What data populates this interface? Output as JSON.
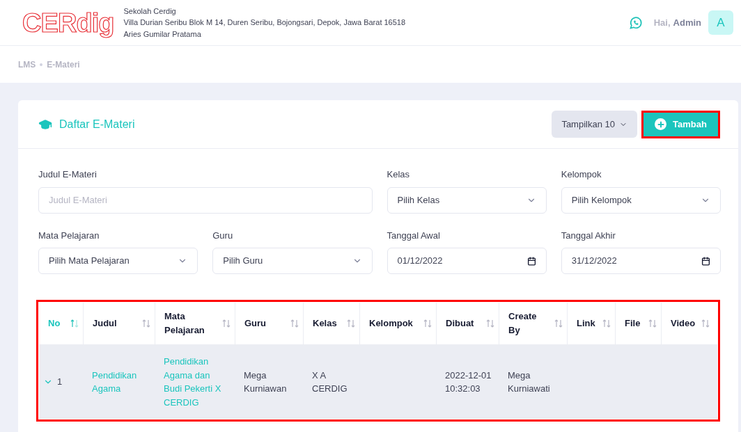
{
  "header": {
    "logo": "CERdig",
    "school_name": "Sekolah Cerdig",
    "address": "Villa Durian Seribu Blok M 14, Duren Seribu, Bojongsari, Depok, Jawa Barat 16518",
    "principal": "Aries Gumilar Pratama",
    "greeting": "Hai,",
    "user_name": "Admin",
    "avatar_initial": "A"
  },
  "breadcrumb": [
    "LMS",
    "E-Materi"
  ],
  "card": {
    "title": "Daftar E-Materi",
    "page_size": "Tampilkan 10",
    "add_button": "Tambah"
  },
  "filters": [
    {
      "kind": "text",
      "label": "Judul E-Materi",
      "placeholder": "Judul E-Materi",
      "wide": true
    },
    {
      "kind": "select",
      "label": "Kelas",
      "value": "Pilih Kelas",
      "wide": false
    },
    {
      "kind": "select",
      "label": "Kelompok",
      "value": "Pilih Kelompok",
      "wide": false
    },
    {
      "kind": "select",
      "label": "Mata Pelajaran",
      "value": "Pilih Mata Pelajaran",
      "wide": false
    },
    {
      "kind": "select",
      "label": "Guru",
      "value": "Pilih Guru",
      "wide": false
    },
    {
      "kind": "date",
      "label": "Tanggal Awal",
      "value": "01/12/2022",
      "wide": false
    },
    {
      "kind": "date",
      "label": "Tanggal Akhir",
      "value": "31/12/2022",
      "wide": false
    }
  ],
  "table": {
    "columns": [
      {
        "label": "No",
        "sorted": true
      },
      {
        "label": "Judul",
        "sorted": false
      },
      {
        "label": "Mata Pelajaran",
        "sorted": false
      },
      {
        "label": "Guru",
        "sorted": false
      },
      {
        "label": "Kelas",
        "sorted": false
      },
      {
        "label": "Kelompok",
        "sorted": false
      },
      {
        "label": "Dibuat",
        "sorted": false
      },
      {
        "label": "Create By",
        "sorted": false
      },
      {
        "label": "Link",
        "sorted": false
      },
      {
        "label": "File",
        "sorted": false
      },
      {
        "label": "Video",
        "sorted": false
      }
    ],
    "rows": [
      {
        "expanded": true,
        "no": "1",
        "judul": "Pendidikan Agama",
        "mata_pelajaran": "Pendidikan Agama dan Budi Pekerti X CERDIG",
        "guru": "Mega Kurniawan",
        "kelas": "X A CERDIG",
        "dibuat": "2022-12-01 10:32:03",
        "create_by": "Mega Kurniawati"
      }
    ]
  }
}
